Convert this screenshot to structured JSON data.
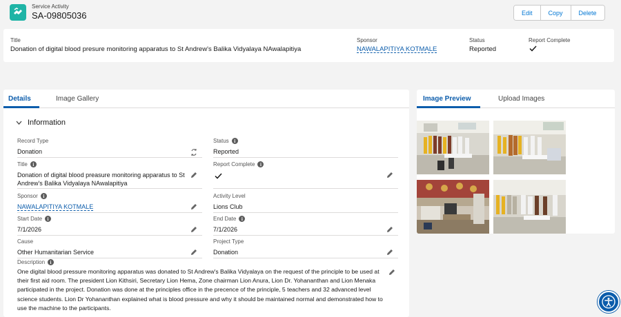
{
  "header": {
    "object_label": "Service Activity",
    "record_number": "SA-09805036",
    "buttons": {
      "edit": "Edit",
      "copy": "Copy",
      "delete": "Delete"
    }
  },
  "highlights": {
    "title_label": "Title",
    "title_value": "Donation of digital blood presure monitoring apparatus to St Andrew's Balika Vidyalaya NAwalapitiya",
    "sponsor_label": "Sponsor",
    "sponsor_value": "NAWALAPITIYA KOTMALE",
    "status_label": "Status",
    "status_value": "Reported",
    "report_label": "Report Complete",
    "report_checked": true
  },
  "left_tabs": {
    "details": "Details",
    "gallery": "Image Gallery"
  },
  "section": {
    "title": "Information"
  },
  "fields": {
    "record_type": {
      "label": "Record Type",
      "value": "Donation"
    },
    "status": {
      "label": "Status",
      "value": "Reported"
    },
    "title": {
      "label": "Title",
      "value": "Donation of digital blood preasure monitoring apparatus to St Andrew's Balika Vidyalaya NAwalapitiya"
    },
    "report_complete": {
      "label": "Report Complete",
      "checked": true
    },
    "sponsor": {
      "label": "Sponsor",
      "value": "NAWALAPITIYA KOTMALE"
    },
    "activity_level": {
      "label": "Activity Level",
      "value": "Lions Club"
    },
    "start_date": {
      "label": "Start Date",
      "value": "7/1/2026"
    },
    "end_date": {
      "label": "End Date",
      "value": "7/1/2026"
    },
    "cause": {
      "label": "Cause",
      "value": "Other Humanitarian Service"
    },
    "project_type": {
      "label": "Project Type",
      "value": "Donation"
    },
    "description": {
      "label": "Description",
      "value": "One digital blood pressure monitoring apparatus was donated to St Andrew's Balika Vidyalaya on the request of the principle to be used at their first aid room. The president Lion Kithsiri, Secretary Lion Hema, Zone chairman Lion Anura, Lion Dr. Yohananthan and Lion Menaka participated in the project. Donation was done at the principles office in the precence of the principle, 5 teachers and 32 advanced level science students. Lion Dr Yohananthan explained what is blood pressure and why it should be maintained normal and demonstrated how to use the machine to the participants."
    }
  },
  "right_tabs": {
    "preview": "Image Preview",
    "upload": "Upload Images"
  },
  "images": [
    "photo-group-1",
    "photo-group-2",
    "photo-office-3",
    "photo-group-4"
  ],
  "colors": {
    "brand": "#0b5cab",
    "icon_teal": "#1fb4a6",
    "background": "#f3f3f3"
  }
}
